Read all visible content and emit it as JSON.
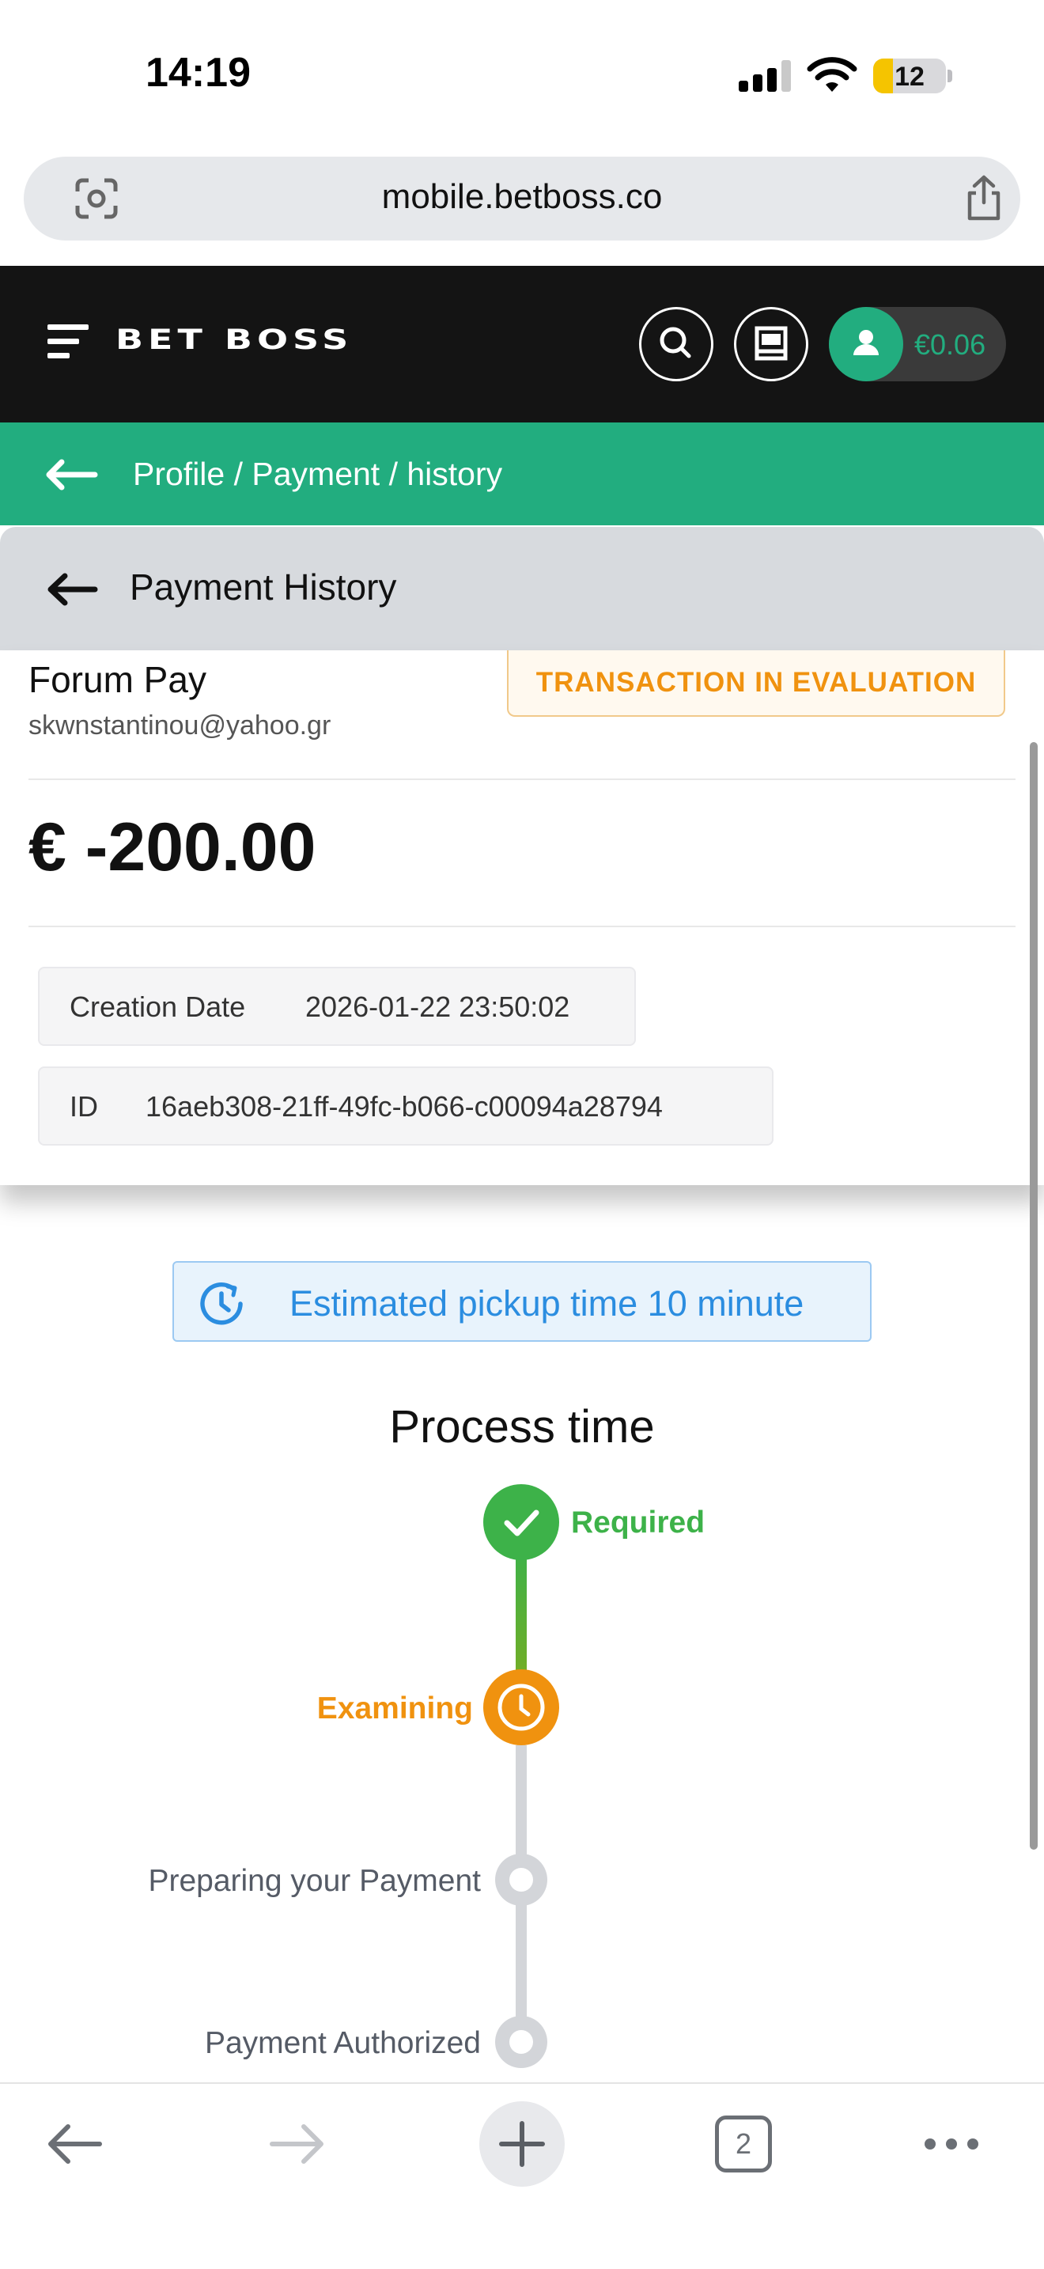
{
  "status_bar": {
    "time": "14:19",
    "battery_level": "12"
  },
  "browser": {
    "url": "mobile.betboss.co",
    "tab_count": "2"
  },
  "site_header": {
    "logo_text": "BET BOSS",
    "balance": "€0.06"
  },
  "breadcrumb": {
    "text": "Profile / Payment / history"
  },
  "page": {
    "title": "Payment History"
  },
  "transaction": {
    "provider": "Forum Pay",
    "email": "skwnstantinou@yahoo.gr",
    "status": "TRANSACTION IN EVALUATION",
    "amount": "€ -200.00",
    "creation_date_label": "Creation Date",
    "creation_date": "2026-01-22 23:50:02",
    "id_label": "ID",
    "id": "16aeb308-21ff-49fc-b066-c00094a28794"
  },
  "pickup": {
    "text": "Estimated pickup time 10 minute"
  },
  "process": {
    "title": "Process time",
    "steps": [
      {
        "label": "Required",
        "state": "done"
      },
      {
        "label": "Examining",
        "state": "active"
      },
      {
        "label": "Preparing your Payment",
        "state": "pending"
      },
      {
        "label": "Payment Authorized",
        "state": "pending"
      }
    ]
  },
  "colors": {
    "brand_green": "#22ad7f",
    "header_dark": "#141414",
    "status_orange": "#f0920f",
    "done_green": "#3db249",
    "info_blue": "#2b8de0"
  },
  "icons": {
    "lens": "google-lens-icon",
    "share": "share-icon",
    "menu": "hamburger-menu-icon",
    "search": "search-icon",
    "cashier": "cashier-icon",
    "user": "user-icon",
    "back": "arrow-left-icon",
    "clock": "clock-refresh-icon",
    "check": "check-icon"
  }
}
